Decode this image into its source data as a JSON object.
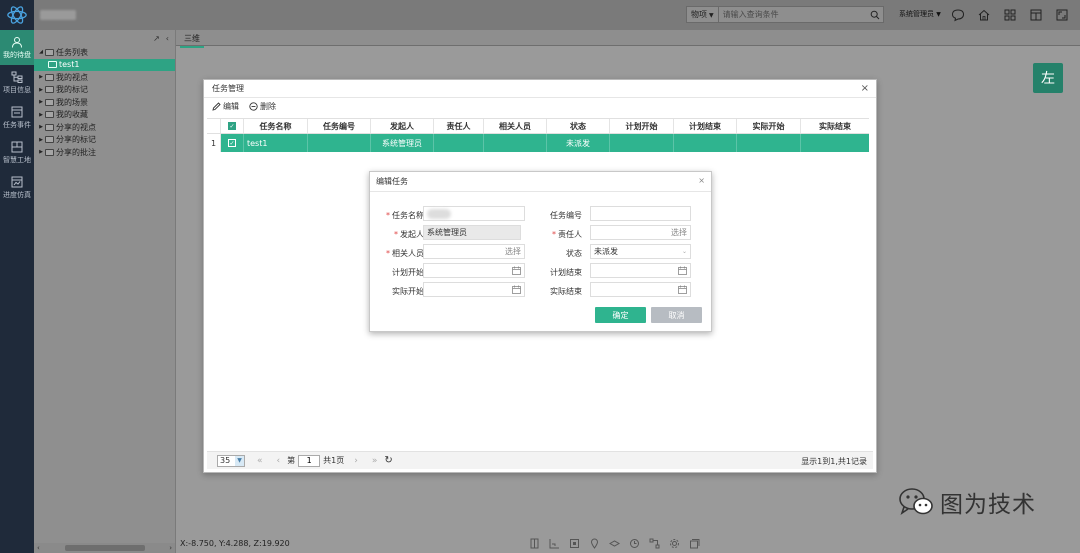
{
  "header": {
    "search_type": "物项",
    "search_placeholder": "请输入查询条件",
    "user_label": "系统管理员"
  },
  "nav": {
    "items": [
      {
        "label": "我的待盘",
        "icon": "user-icon",
        "active": true
      },
      {
        "label": "项目信息",
        "icon": "hierarchy-icon",
        "active": false
      },
      {
        "label": "任务事件",
        "icon": "task-icon",
        "active": false
      },
      {
        "label": "智慧工地",
        "icon": "site-icon",
        "active": false
      },
      {
        "label": "进度仿真",
        "icon": "simulation-icon",
        "active": false
      }
    ]
  },
  "tree": {
    "items": [
      {
        "label": "任务列表",
        "expanded": true,
        "level": 0
      },
      {
        "label": "test1",
        "level": 1,
        "selected": true
      },
      {
        "label": "我的视点",
        "level": 0
      },
      {
        "label": "我的标记",
        "level": 0
      },
      {
        "label": "我的场景",
        "level": 0
      },
      {
        "label": "我的收藏",
        "level": 0
      },
      {
        "label": "分享的视点",
        "level": 0
      },
      {
        "label": "分享的标记",
        "level": 0
      },
      {
        "label": "分享的批注",
        "level": 0
      }
    ]
  },
  "tabs": {
    "active_label": "三维"
  },
  "side_badge": "左",
  "status": {
    "coords": "X:-8.750, Y:4.288, Z:19.920"
  },
  "task_dialog": {
    "title": "任务管理",
    "toolbar": {
      "edit_label": "编辑",
      "delete_label": "删除"
    },
    "columns": [
      "任务名称",
      "任务编号",
      "发起人",
      "责任人",
      "相关人员",
      "状态",
      "计划开始",
      "计划结束",
      "实际开始",
      "实际结束"
    ],
    "rows": [
      {
        "num": "1",
        "name": "test1",
        "code": "",
        "initiator": "系统管理员",
        "owner": "",
        "related": "",
        "status": "未派发",
        "plan_start": "",
        "plan_end": "",
        "actual_start": "",
        "actual_end": ""
      }
    ],
    "pager": {
      "page_size": "35",
      "page_prefix": "第",
      "page_value": "1",
      "page_suffix": "共1页",
      "info": "显示1到1,共1记录"
    }
  },
  "edit_dialog": {
    "title": "编辑任务",
    "labels": {
      "name": "任务名称",
      "code": "任务编号",
      "initiator": "发起人",
      "owner": "责任人",
      "related": "相关人员",
      "status": "状态",
      "plan_start": "计划开始",
      "plan_end": "计划结束",
      "actual_start": "实际开始",
      "actual_end": "实际结束"
    },
    "values": {
      "initiator": "系统管理员",
      "status": "未派发",
      "select_hint": "选择"
    },
    "ok_label": "确定",
    "cancel_label": "取消"
  },
  "watermark": {
    "text": "图为技术"
  },
  "colors": {
    "accent": "#2fb48f",
    "nav_bg": "#1f2a3a",
    "required": "#e04848"
  }
}
